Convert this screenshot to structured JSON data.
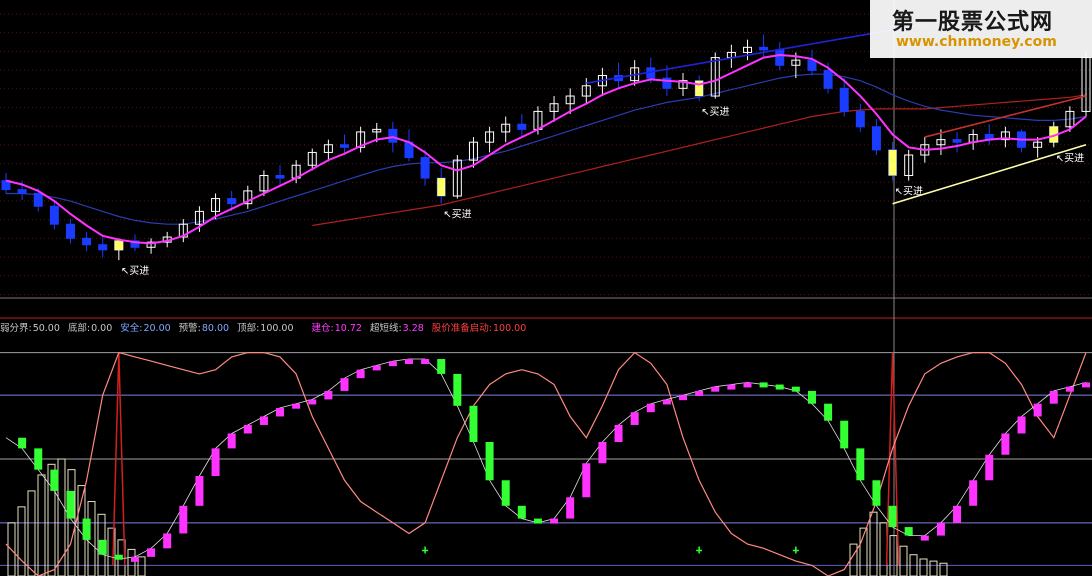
{
  "watermark": {
    "title": "第一股票公式网",
    "url": "www.chnmoney.com"
  },
  "indicator_legend": [
    {
      "label": "弱分界:",
      "value": "50.00",
      "label_color": "#c8c8c8",
      "value_color": "#c8c8c8"
    },
    {
      "label": "底部:",
      "value": "0.00",
      "label_color": "#c8c8c8",
      "value_color": "#c8c8c8"
    },
    {
      "label": "安全:",
      "value": "20.00",
      "label_color": "#7fa7ff",
      "value_color": "#7fa7ff"
    },
    {
      "label": "预警:",
      "value": "80.00",
      "label_color": "#c8c8c8",
      "value_color": "#7fa7ff"
    },
    {
      "label": "顶部:",
      "value": "100.00",
      "label_color": "#c8c8c8",
      "value_color": "#c8c8c8"
    },
    {
      "label": "建仓:",
      "value": "10.72",
      "label_color": "#ff3cff",
      "value_color": "#ff3cff"
    },
    {
      "label": "超短线:",
      "value": "3.28",
      "label_color": "#c8c8c8",
      "value_color": "#ff3cff"
    },
    {
      "label": "股价准备启动:",
      "value": "100.00",
      "label_color": "#ff4040",
      "value_color": "#ff4040"
    }
  ],
  "buy_labels": [
    "↖买进",
    "↖买进",
    "↖买进",
    "↖买进",
    "↖买进"
  ],
  "colors": {
    "up_candle": "#ffff66",
    "down_candle": "#1a3cff",
    "ma_fast": "#ff33ff",
    "ma_mid": "#2a3cb0",
    "ma_slow": "#b02020",
    "trend_top": "#2222dd",
    "trend_red": "#c83030",
    "trend_yellow": "#ffffaa",
    "osc_line": "#ff8a80",
    "bar_magenta": "#ff33ff",
    "bar_green": "#33ff33"
  },
  "chart_data": [
    {
      "type": "candlestick",
      "title": "",
      "ohlc": [
        [
          10.9,
          10.96,
          10.8,
          10.83
        ],
        [
          10.83,
          10.9,
          10.75,
          10.8
        ],
        [
          10.8,
          10.84,
          10.66,
          10.7
        ],
        [
          10.7,
          10.75,
          10.52,
          10.56
        ],
        [
          10.56,
          10.6,
          10.41,
          10.45
        ],
        [
          10.45,
          10.5,
          10.35,
          10.4
        ],
        [
          10.4,
          10.46,
          10.3,
          10.36
        ],
        [
          10.36,
          10.45,
          10.28,
          10.43
        ],
        [
          10.43,
          10.48,
          10.35,
          10.38
        ],
        [
          10.38,
          10.45,
          10.33,
          10.42
        ],
        [
          10.42,
          10.5,
          10.38,
          10.46
        ],
        [
          10.46,
          10.6,
          10.42,
          10.56
        ],
        [
          10.56,
          10.7,
          10.5,
          10.66
        ],
        [
          10.66,
          10.8,
          10.6,
          10.76
        ],
        [
          10.76,
          10.82,
          10.66,
          10.72
        ],
        [
          10.72,
          10.86,
          10.68,
          10.82
        ],
        [
          10.82,
          10.98,
          10.78,
          10.94
        ],
        [
          10.94,
          11.02,
          10.86,
          10.92
        ],
        [
          10.92,
          11.06,
          10.88,
          11.02
        ],
        [
          11.02,
          11.15,
          10.98,
          11.12
        ],
        [
          11.12,
          11.22,
          11.05,
          11.18
        ],
        [
          11.18,
          11.26,
          11.1,
          11.16
        ],
        [
          11.16,
          11.32,
          11.12,
          11.28
        ],
        [
          11.28,
          11.35,
          11.2,
          11.3
        ],
        [
          11.3,
          11.36,
          11.12,
          11.2
        ],
        [
          11.2,
          11.3,
          11.05,
          11.08
        ],
        [
          11.08,
          11.14,
          10.86,
          10.92
        ],
        [
          10.92,
          11.0,
          10.72,
          10.78
        ],
        [
          10.78,
          11.1,
          10.76,
          11.06
        ],
        [
          11.06,
          11.24,
          11.0,
          11.2
        ],
        [
          11.2,
          11.32,
          11.12,
          11.28
        ],
        [
          11.28,
          11.4,
          11.2,
          11.34
        ],
        [
          11.34,
          11.42,
          11.24,
          11.3
        ],
        [
          11.3,
          11.48,
          11.26,
          11.44
        ],
        [
          11.44,
          11.56,
          11.36,
          11.5
        ],
        [
          11.5,
          11.62,
          11.42,
          11.56
        ],
        [
          11.56,
          11.7,
          11.5,
          11.64
        ],
        [
          11.64,
          11.78,
          11.56,
          11.72
        ],
        [
          11.72,
          11.82,
          11.62,
          11.68
        ],
        [
          11.68,
          11.84,
          11.64,
          11.78
        ],
        [
          11.78,
          11.86,
          11.66,
          11.7
        ],
        [
          11.7,
          11.8,
          11.56,
          11.62
        ],
        [
          11.62,
          11.74,
          11.56,
          11.68
        ],
        [
          11.68,
          11.72,
          11.52,
          11.56
        ],
        [
          11.56,
          11.9,
          11.54,
          11.86
        ],
        [
          11.86,
          11.96,
          11.78,
          11.9
        ],
        [
          11.9,
          12.0,
          11.84,
          11.94
        ],
        [
          11.94,
          12.04,
          11.86,
          11.92
        ],
        [
          11.92,
          11.98,
          11.76,
          11.8
        ],
        [
          11.8,
          11.9,
          11.7,
          11.84
        ],
        [
          11.84,
          11.92,
          11.72,
          11.76
        ],
        [
          11.76,
          11.82,
          11.58,
          11.62
        ],
        [
          11.62,
          11.7,
          11.4,
          11.44
        ],
        [
          11.44,
          11.5,
          11.28,
          11.32
        ],
        [
          11.32,
          11.38,
          11.1,
          11.14
        ],
        [
          11.14,
          11.2,
          10.9,
          10.94
        ],
        [
          10.94,
          11.14,
          10.9,
          11.1
        ],
        [
          11.1,
          11.24,
          11.04,
          11.18
        ],
        [
          11.18,
          11.3,
          11.1,
          11.22
        ],
        [
          11.22,
          11.28,
          11.12,
          11.2
        ],
        [
          11.2,
          11.3,
          11.14,
          11.26
        ],
        [
          11.26,
          11.34,
          11.18,
          11.22
        ],
        [
          11.22,
          11.32,
          11.16,
          11.28
        ],
        [
          11.28,
          11.3,
          11.12,
          11.16
        ],
        [
          11.16,
          11.24,
          11.08,
          11.2
        ],
        [
          11.2,
          11.36,
          11.16,
          11.32
        ],
        [
          11.32,
          11.48,
          11.28,
          11.44
        ],
        [
          11.44,
          11.9,
          11.4,
          11.86
        ]
      ],
      "ma_fast": [
        10.9,
        10.87,
        10.82,
        10.74,
        10.64,
        10.55,
        10.47,
        10.44,
        10.42,
        10.41,
        10.43,
        10.47,
        10.54,
        10.62,
        10.68,
        10.74,
        10.8,
        10.86,
        10.92,
        10.99,
        11.06,
        11.11,
        11.17,
        11.22,
        11.24,
        11.2,
        11.12,
        11.02,
        10.98,
        11.02,
        11.1,
        11.18,
        11.24,
        11.3,
        11.37,
        11.44,
        11.5,
        11.57,
        11.62,
        11.66,
        11.69,
        11.68,
        11.67,
        11.65,
        11.68,
        11.74,
        11.8,
        11.86,
        11.88,
        11.87,
        11.85,
        11.78,
        11.68,
        11.56,
        11.42,
        11.26,
        11.16,
        11.14,
        11.15,
        11.17,
        11.2,
        11.22,
        11.23,
        11.22,
        11.22,
        11.25,
        11.3,
        11.4
      ],
      "ma_mid": [
        10.8,
        10.8,
        10.79,
        10.77,
        10.74,
        10.7,
        10.66,
        10.62,
        10.59,
        10.57,
        10.56,
        10.56,
        10.58,
        10.6,
        10.63,
        10.66,
        10.7,
        10.74,
        10.78,
        10.82,
        10.86,
        10.9,
        10.94,
        10.98,
        11.01,
        11.03,
        11.04,
        11.04,
        11.05,
        11.07,
        11.1,
        11.13,
        11.17,
        11.21,
        11.25,
        11.29,
        11.33,
        11.37,
        11.41,
        11.45,
        11.48,
        11.51,
        11.53,
        11.55,
        11.58,
        11.61,
        11.64,
        11.67,
        11.7,
        11.72,
        11.73,
        11.73,
        11.71,
        11.68,
        11.63,
        11.57,
        11.52,
        11.48,
        11.45,
        11.43,
        11.41,
        11.4,
        11.39,
        11.38,
        11.37,
        11.37,
        11.38,
        11.4
      ],
      "ma_slow": [
        null,
        null,
        null,
        null,
        null,
        null,
        null,
        null,
        null,
        null,
        null,
        null,
        null,
        null,
        null,
        null,
        null,
        null,
        null,
        10.55,
        10.57,
        10.59,
        10.61,
        10.63,
        10.65,
        10.67,
        10.69,
        10.71,
        10.74,
        10.77,
        10.8,
        10.83,
        10.86,
        10.89,
        10.92,
        10.95,
        10.98,
        11.01,
        11.04,
        11.07,
        11.1,
        11.13,
        11.16,
        11.19,
        11.22,
        11.25,
        11.28,
        11.31,
        11.34,
        11.37,
        11.4,
        11.42,
        11.44,
        11.45,
        11.46,
        11.46,
        11.46,
        11.46,
        11.47,
        11.48,
        11.49,
        11.5,
        11.51,
        11.52,
        11.53,
        11.54,
        11.55,
        11.57
      ],
      "buy_signal_index": [
        7,
        27,
        43,
        55,
        65
      ],
      "trendlines": [
        {
          "color": "trend_top",
          "from": [
            36,
            11.66
          ],
          "to": [
            57,
            12.12
          ]
        },
        {
          "color": "trend_red",
          "from": [
            57,
            11.24
          ],
          "to": [
            67,
            11.56
          ]
        },
        {
          "color": "trend_yellow",
          "from": [
            55,
            10.72
          ],
          "to": [
            67,
            11.18
          ]
        }
      ],
      "ylim": [
        10.0,
        12.2
      ]
    },
    {
      "type": "oscillator",
      "title": "",
      "levels": [
        0,
        20,
        50,
        80,
        100
      ],
      "ylim": [
        -5,
        105
      ],
      "bars": [
        60,
        55,
        45,
        35,
        22,
        12,
        5,
        3,
        4,
        8,
        15,
        28,
        42,
        55,
        62,
        66,
        70,
        74,
        76,
        78,
        82,
        88,
        92,
        94,
        96,
        97,
        97,
        90,
        75,
        58,
        40,
        28,
        22,
        20,
        22,
        32,
        48,
        58,
        66,
        72,
        76,
        78,
        80,
        82,
        84,
        85,
        86,
        85,
        84,
        82,
        76,
        68,
        55,
        40,
        28,
        18,
        14,
        14,
        20,
        28,
        40,
        52,
        62,
        70,
        76,
        82,
        84,
        86
      ],
      "osc_line": [
        10,
        2,
        -5,
        -2,
        10,
        40,
        80,
        100,
        98,
        96,
        94,
        92,
        90,
        92,
        98,
        100,
        100,
        98,
        90,
        70,
        55,
        40,
        30,
        25,
        20,
        15,
        20,
        40,
        60,
        75,
        85,
        90,
        92,
        90,
        85,
        70,
        60,
        75,
        92,
        100,
        95,
        85,
        60,
        40,
        25,
        15,
        10,
        8,
        5,
        2,
        0,
        -5,
        -2,
        10,
        30,
        55,
        75,
        90,
        95,
        98,
        100,
        100,
        95,
        85,
        70,
        60,
        80,
        100
      ],
      "spike_index": [
        7,
        55
      ],
      "spike_value": 100,
      "up_markers_index": [
        26,
        43,
        49
      ]
    }
  ]
}
